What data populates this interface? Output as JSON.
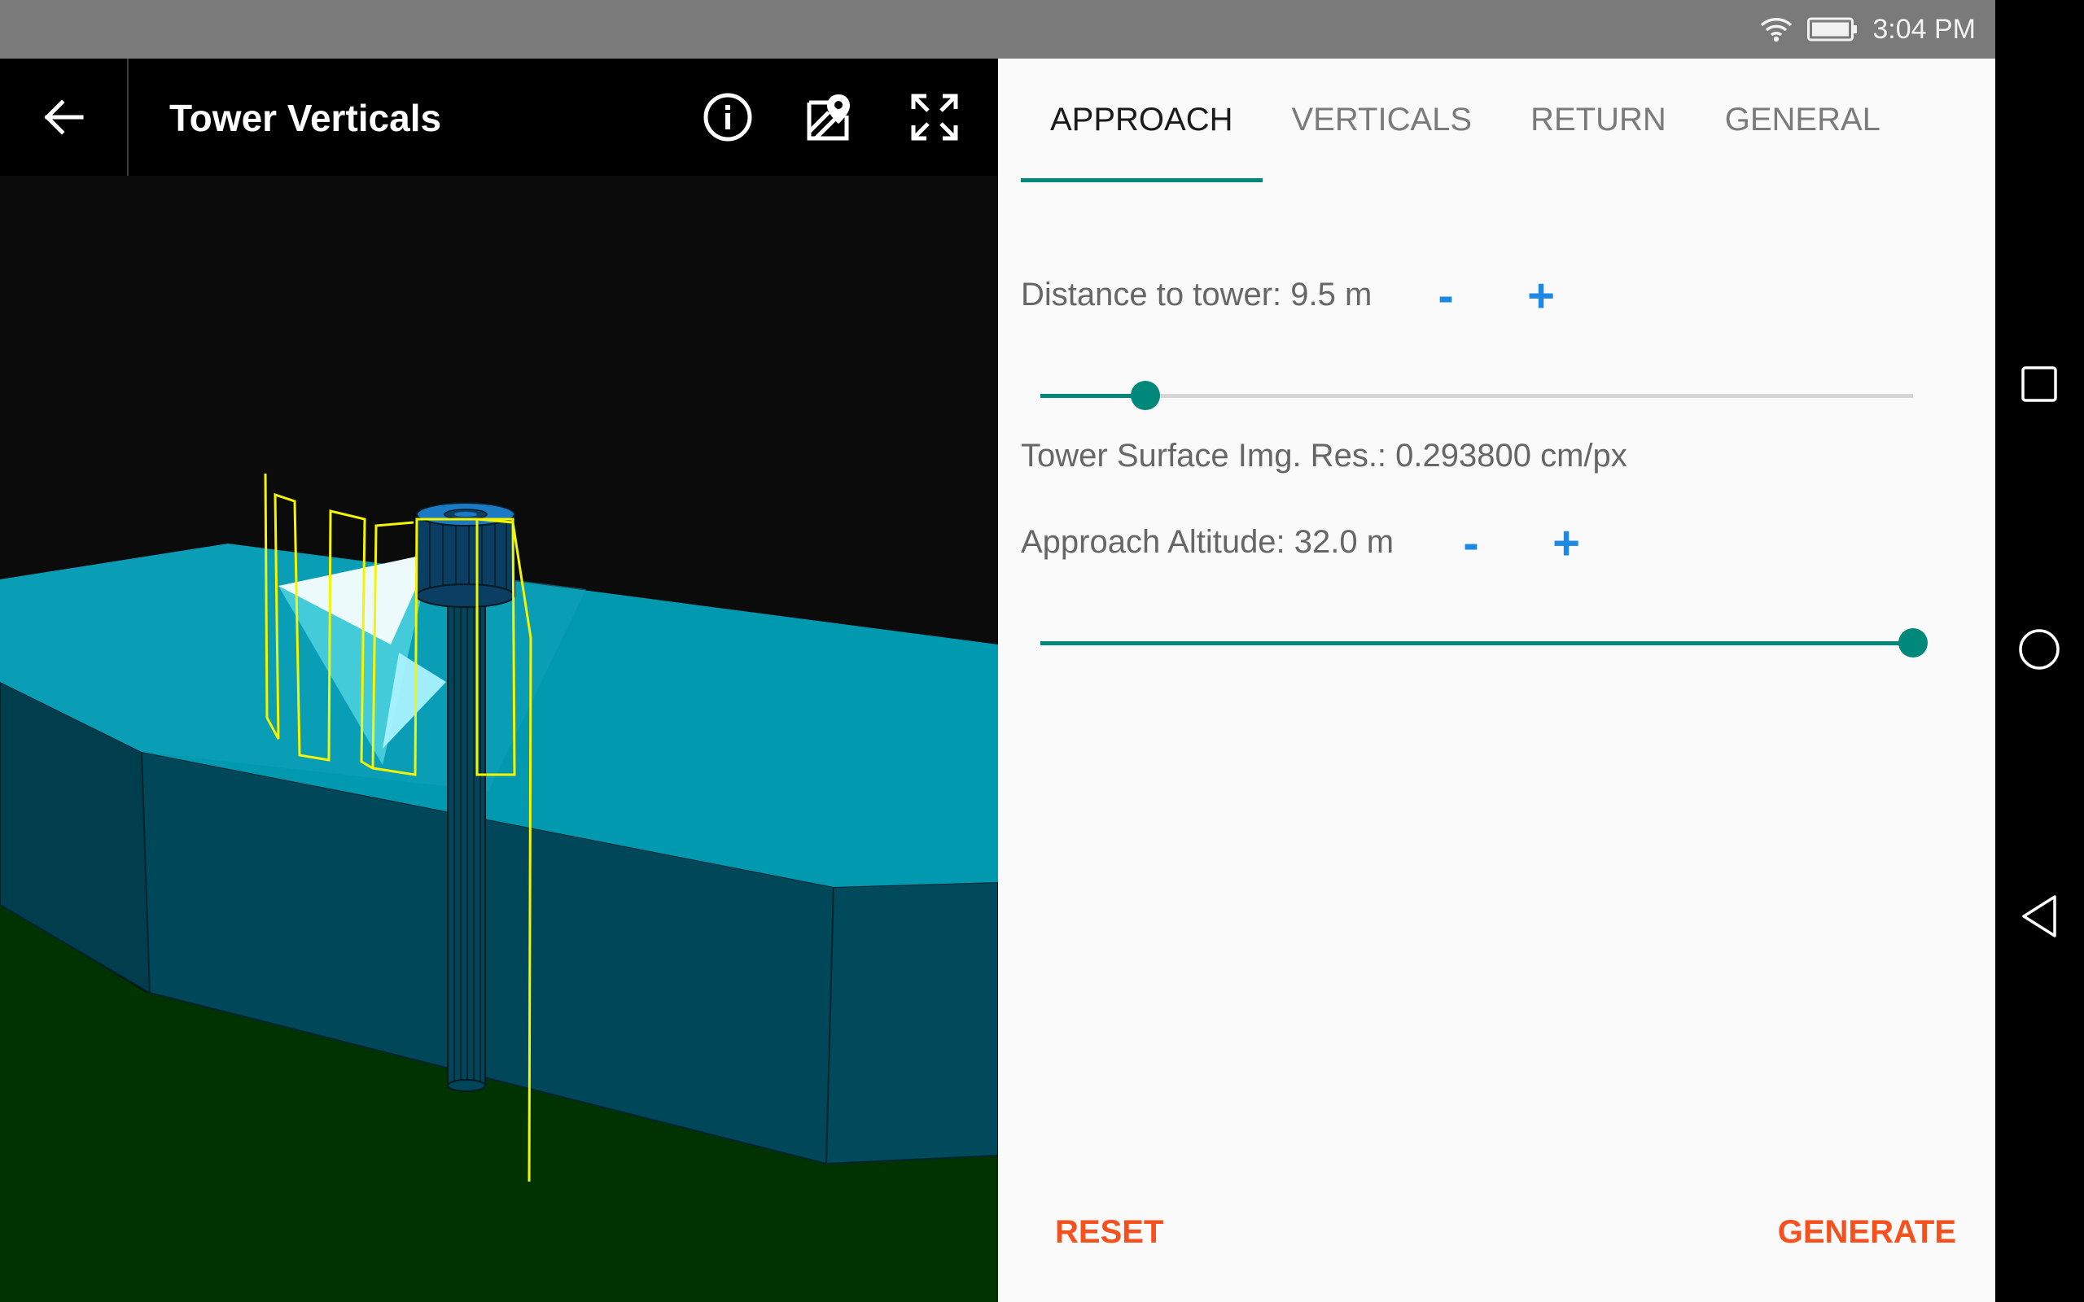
{
  "status_bar": {
    "time": "3:04 PM",
    "icons": [
      "wifi-icon",
      "battery-icon"
    ]
  },
  "toolbar": {
    "title": "Tower Verticals",
    "icons": [
      "back-arrow-icon",
      "info-icon",
      "map-marker-icon",
      "fullscreen-icon"
    ]
  },
  "tabs": [
    {
      "label": "APPROACH",
      "active": true
    },
    {
      "label": "VERTICALS",
      "active": false
    },
    {
      "label": "RETURN",
      "active": false
    },
    {
      "label": "GENERAL",
      "active": false
    }
  ],
  "settings": {
    "distance_label": "Distance to tower: 9.5 m",
    "distance_minus": "-",
    "distance_plus": "+",
    "distance_slider_fraction": 0.12,
    "resolution_label": "Tower Surface Img. Res.: 0.293800 cm/px",
    "altitude_label": "Approach Altitude: 32.0 m",
    "altitude_minus": "-",
    "altitude_plus": "+",
    "altitude_slider_fraction": 1.0
  },
  "actions": {
    "reset_label": "RESET",
    "generate_label": "GENERATE"
  },
  "colors": {
    "accent": "#00897b",
    "stepper": "#1e88e5",
    "action": "#f4511e",
    "terrain_top": "#0099b0",
    "terrain_side": "#00475a",
    "ground": "#003300",
    "flight_path": "#f5f500"
  },
  "nav_bar": {
    "icons": [
      "recents-square-icon",
      "home-circle-icon",
      "back-triangle-icon"
    ]
  }
}
